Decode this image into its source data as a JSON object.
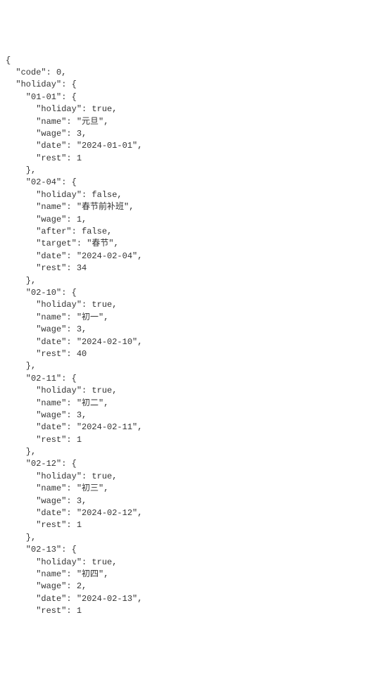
{
  "json": {
    "code": 0,
    "holiday": {
      "01-01": {
        "holiday": true,
        "name": "元旦",
        "wage": 3,
        "date": "2024-01-01",
        "rest": 1
      },
      "02-04": {
        "holiday": false,
        "name": "春节前补班",
        "wage": 1,
        "after": false,
        "target": "春节",
        "date": "2024-02-04",
        "rest": 34
      },
      "02-10": {
        "holiday": true,
        "name": "初一",
        "wage": 3,
        "date": "2024-02-10",
        "rest": 40
      },
      "02-11": {
        "holiday": true,
        "name": "初二",
        "wage": 3,
        "date": "2024-02-11",
        "rest": 1
      },
      "02-12": {
        "holiday": true,
        "name": "初三",
        "wage": 3,
        "date": "2024-02-12",
        "rest": 1
      },
      "02-13": {
        "holiday": true,
        "name": "初四",
        "wage": 2,
        "date": "2024-02-13",
        "rest": 1
      }
    }
  }
}
